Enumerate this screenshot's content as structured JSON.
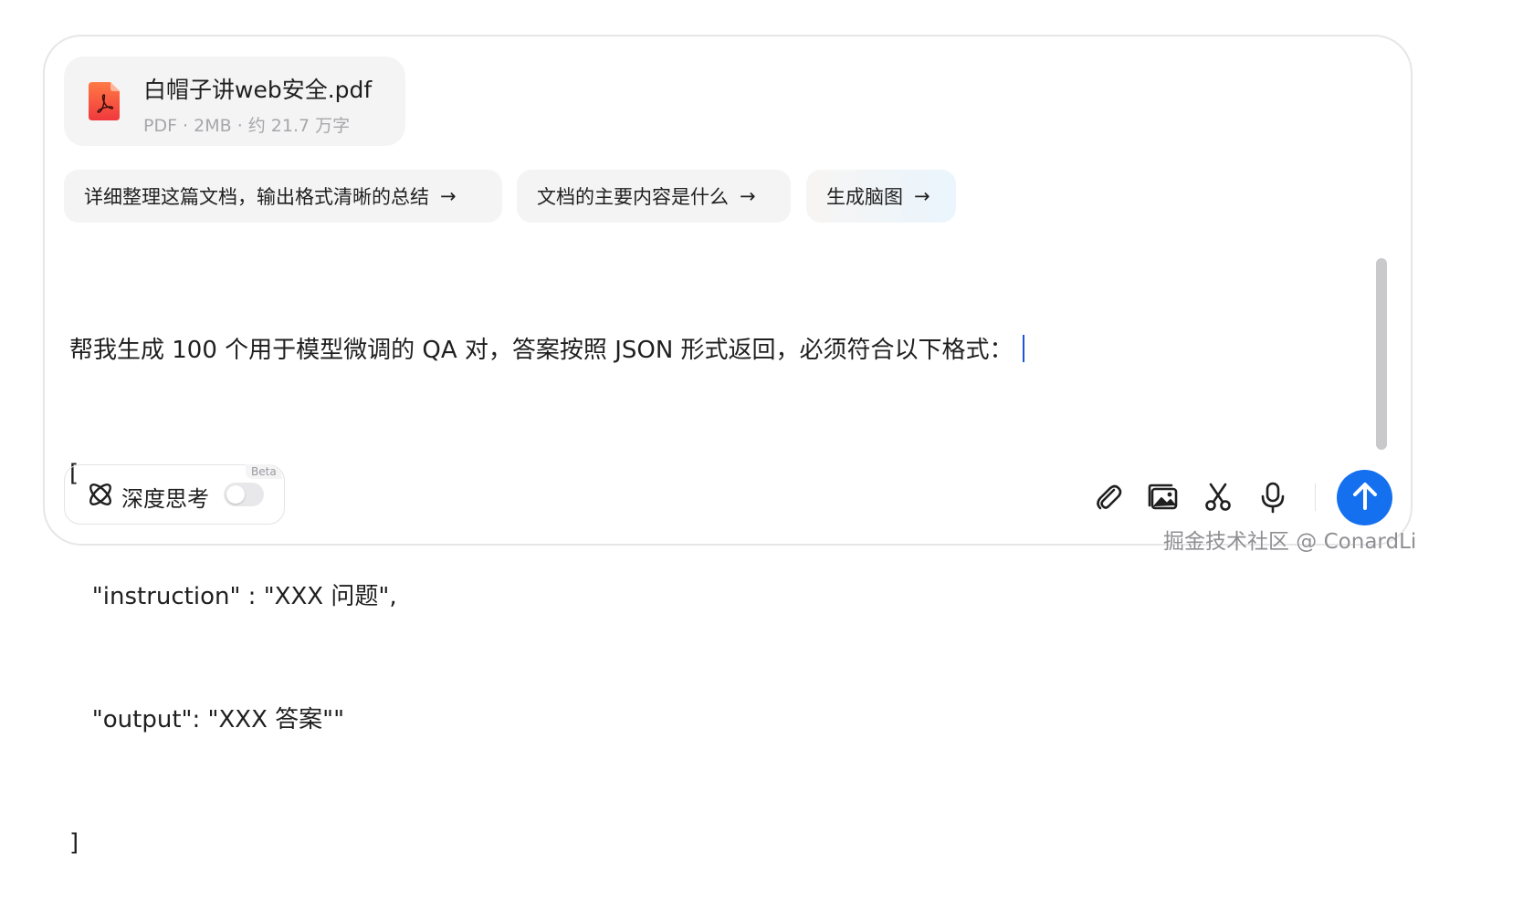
{
  "file": {
    "name": "白帽子讲web安全.pdf",
    "meta": "PDF · 2MB · 约 21.7 万字",
    "icon": "pdf-file-icon"
  },
  "suggestions": [
    {
      "label": "详细整理这篇文档，输出格式清晰的总结",
      "arrow": "→"
    },
    {
      "label": "文档的主要内容是什么",
      "arrow": "→"
    },
    {
      "label": "生成脑图",
      "arrow": "→"
    }
  ],
  "editor": {
    "lines": [
      "帮我生成 100 个用于模型微调的 QA 对，答案按照 JSON 形式返回，必须符合以下格式：",
      "[",
      "   \"instruction\" : \"XXX 问题\",",
      "   \"output\": \"XXX 答案\"\"",
      "]"
    ]
  },
  "deep_think": {
    "label": "深度思考",
    "badge": "Beta",
    "enabled": false
  },
  "tools": [
    "paperclip-icon",
    "image-icon",
    "scissors-icon",
    "microphone-icon"
  ],
  "send": {
    "icon": "arrow-up-icon",
    "color": "#1570ef"
  },
  "watermark": "掘金技术社区 @ ConardLi"
}
